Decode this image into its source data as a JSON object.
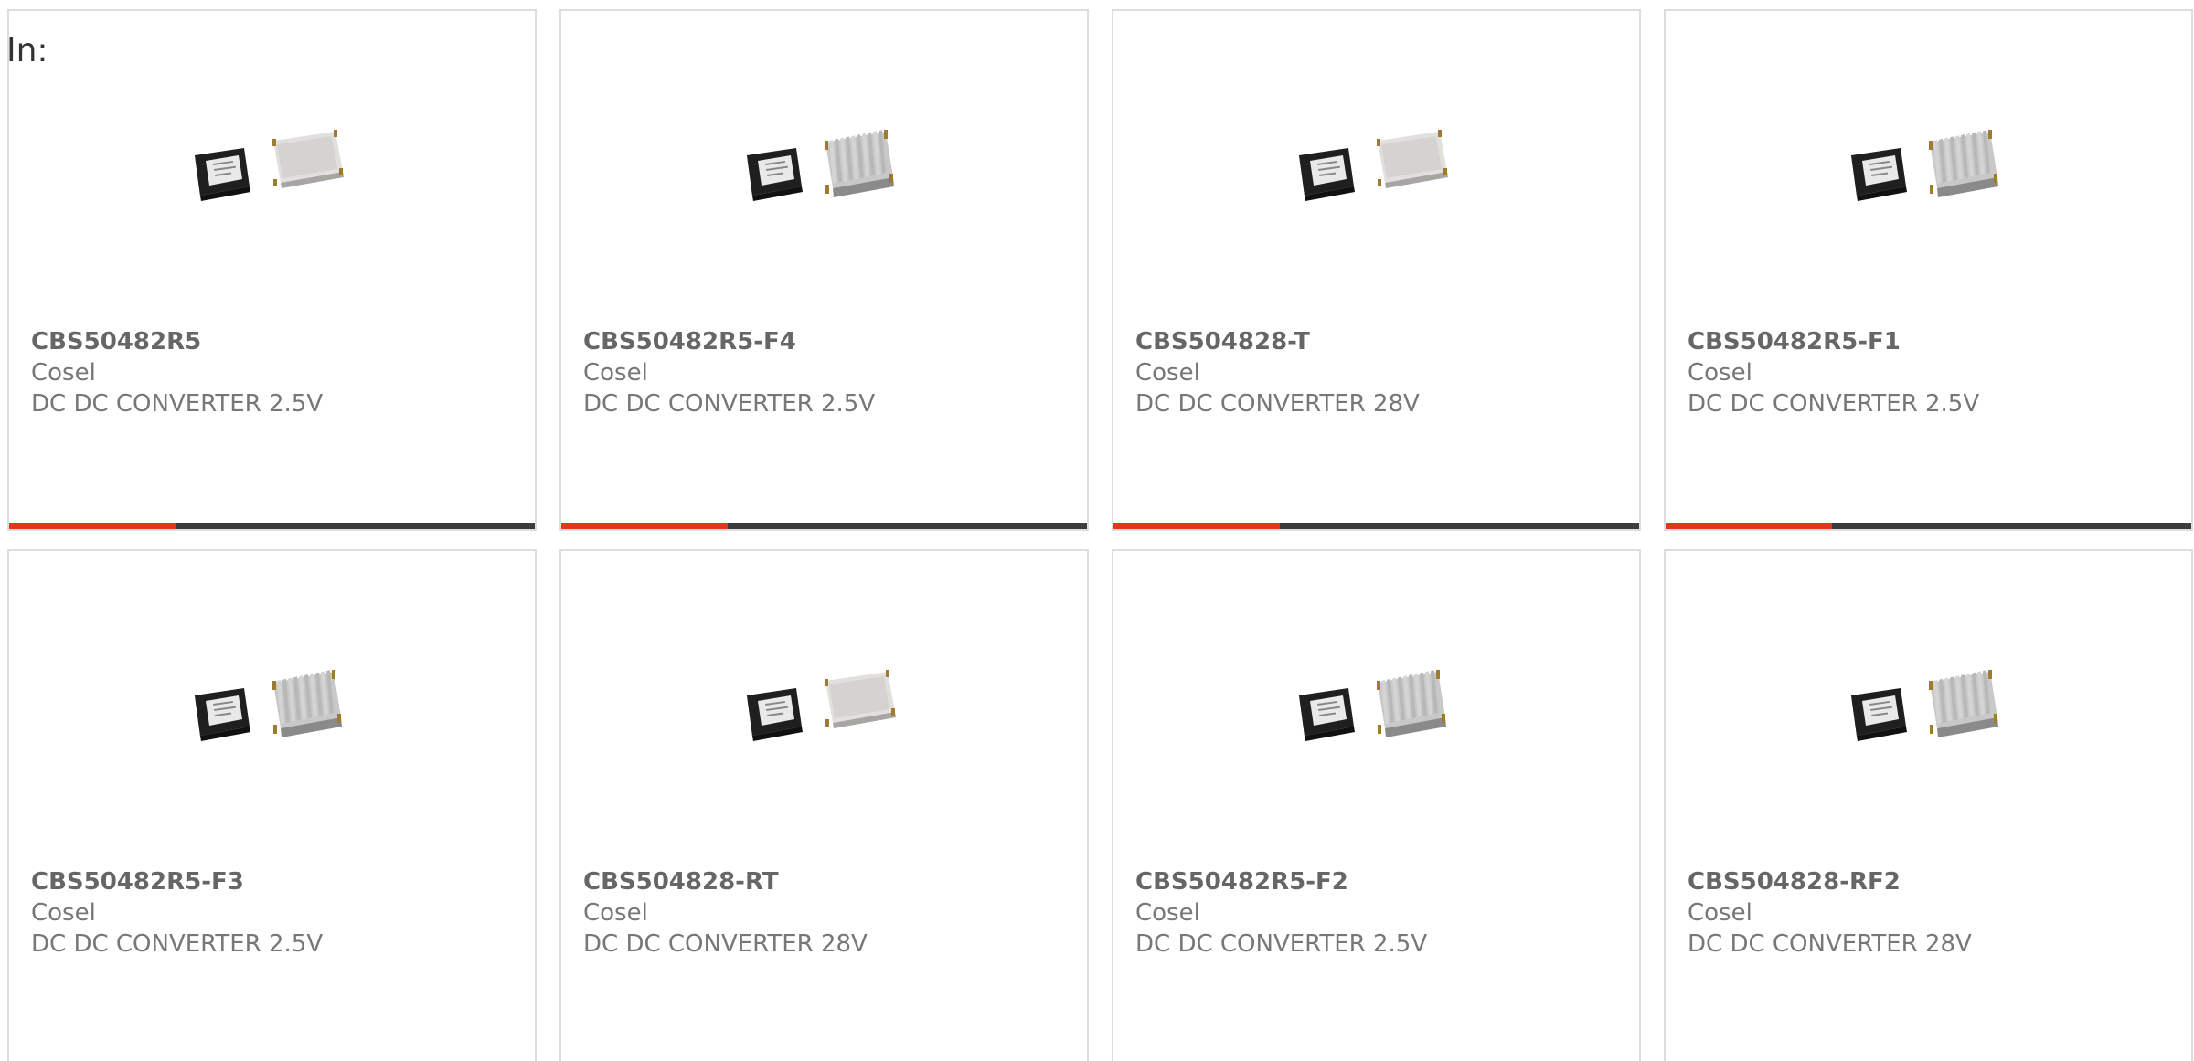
{
  "header": {
    "label": "In:"
  },
  "colors": {
    "accent": "#e4361b",
    "bar": "#3c3c3c",
    "border": "#dddddd",
    "text": "#777777"
  },
  "products": [
    {
      "part": "CBS50482R5",
      "brand": "Cosel",
      "desc": "DC DC CONVERTER 2.5V",
      "image": "flat-cover"
    },
    {
      "part": "CBS50482R5-F4",
      "brand": "Cosel",
      "desc": "DC DC CONVERTER 2.5V",
      "image": "heatsink"
    },
    {
      "part": "CBS504828-T",
      "brand": "Cosel",
      "desc": "DC DC CONVERTER 28V",
      "image": "flat-cover"
    },
    {
      "part": "CBS50482R5-F1",
      "brand": "Cosel",
      "desc": "DC DC CONVERTER 2.5V",
      "image": "heatsink"
    },
    {
      "part": "CBS50482R5-F3",
      "brand": "Cosel",
      "desc": "DC DC CONVERTER 2.5V",
      "image": "heatsink"
    },
    {
      "part": "CBS504828-RT",
      "brand": "Cosel",
      "desc": "DC DC CONVERTER 28V",
      "image": "flat-cover"
    },
    {
      "part": "CBS50482R5-F2",
      "brand": "Cosel",
      "desc": "DC DC CONVERTER 2.5V",
      "image": "heatsink"
    },
    {
      "part": "CBS504828-RF2",
      "brand": "Cosel",
      "desc": "DC DC CONVERTER 28V",
      "image": "heatsink"
    }
  ]
}
